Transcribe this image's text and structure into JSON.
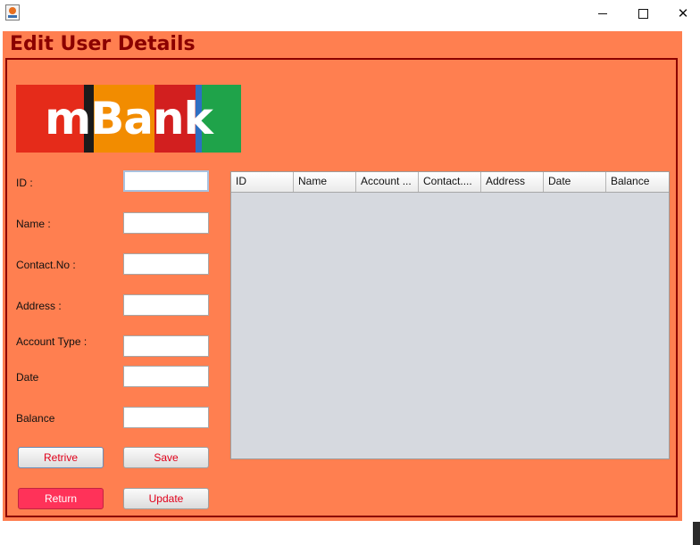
{
  "form": {
    "heading": "Edit User Details",
    "labels": {
      "id": "ID :",
      "name": "Name :",
      "contact": "Contact.No :",
      "address": "Address :",
      "account_type": "Account Type :",
      "date": "Date",
      "balance": "Balance"
    },
    "values": {
      "id": "",
      "name": "",
      "contact": "",
      "address": "",
      "account_type": "",
      "date": "",
      "balance": ""
    },
    "buttons": {
      "retrive": "Retrive",
      "save": "Save",
      "return": "Return",
      "update": "Update"
    }
  },
  "logo": {
    "text": "mBank",
    "colors": [
      "#e52b1a",
      "#1b1b1b",
      "#f28c00",
      "#d21f1f",
      "#2d6fc3",
      "#1fa34a"
    ]
  },
  "table": {
    "columns": [
      "ID",
      "Name",
      "Account ...",
      "Contact....",
      "Address",
      "Date",
      "Balance"
    ],
    "rows": []
  },
  "colors": {
    "background": "#ff7f50",
    "heading": "#8b0000",
    "button_text": "#e0001a",
    "return_button": "#ff3259",
    "table_body": "#d6d9df"
  }
}
